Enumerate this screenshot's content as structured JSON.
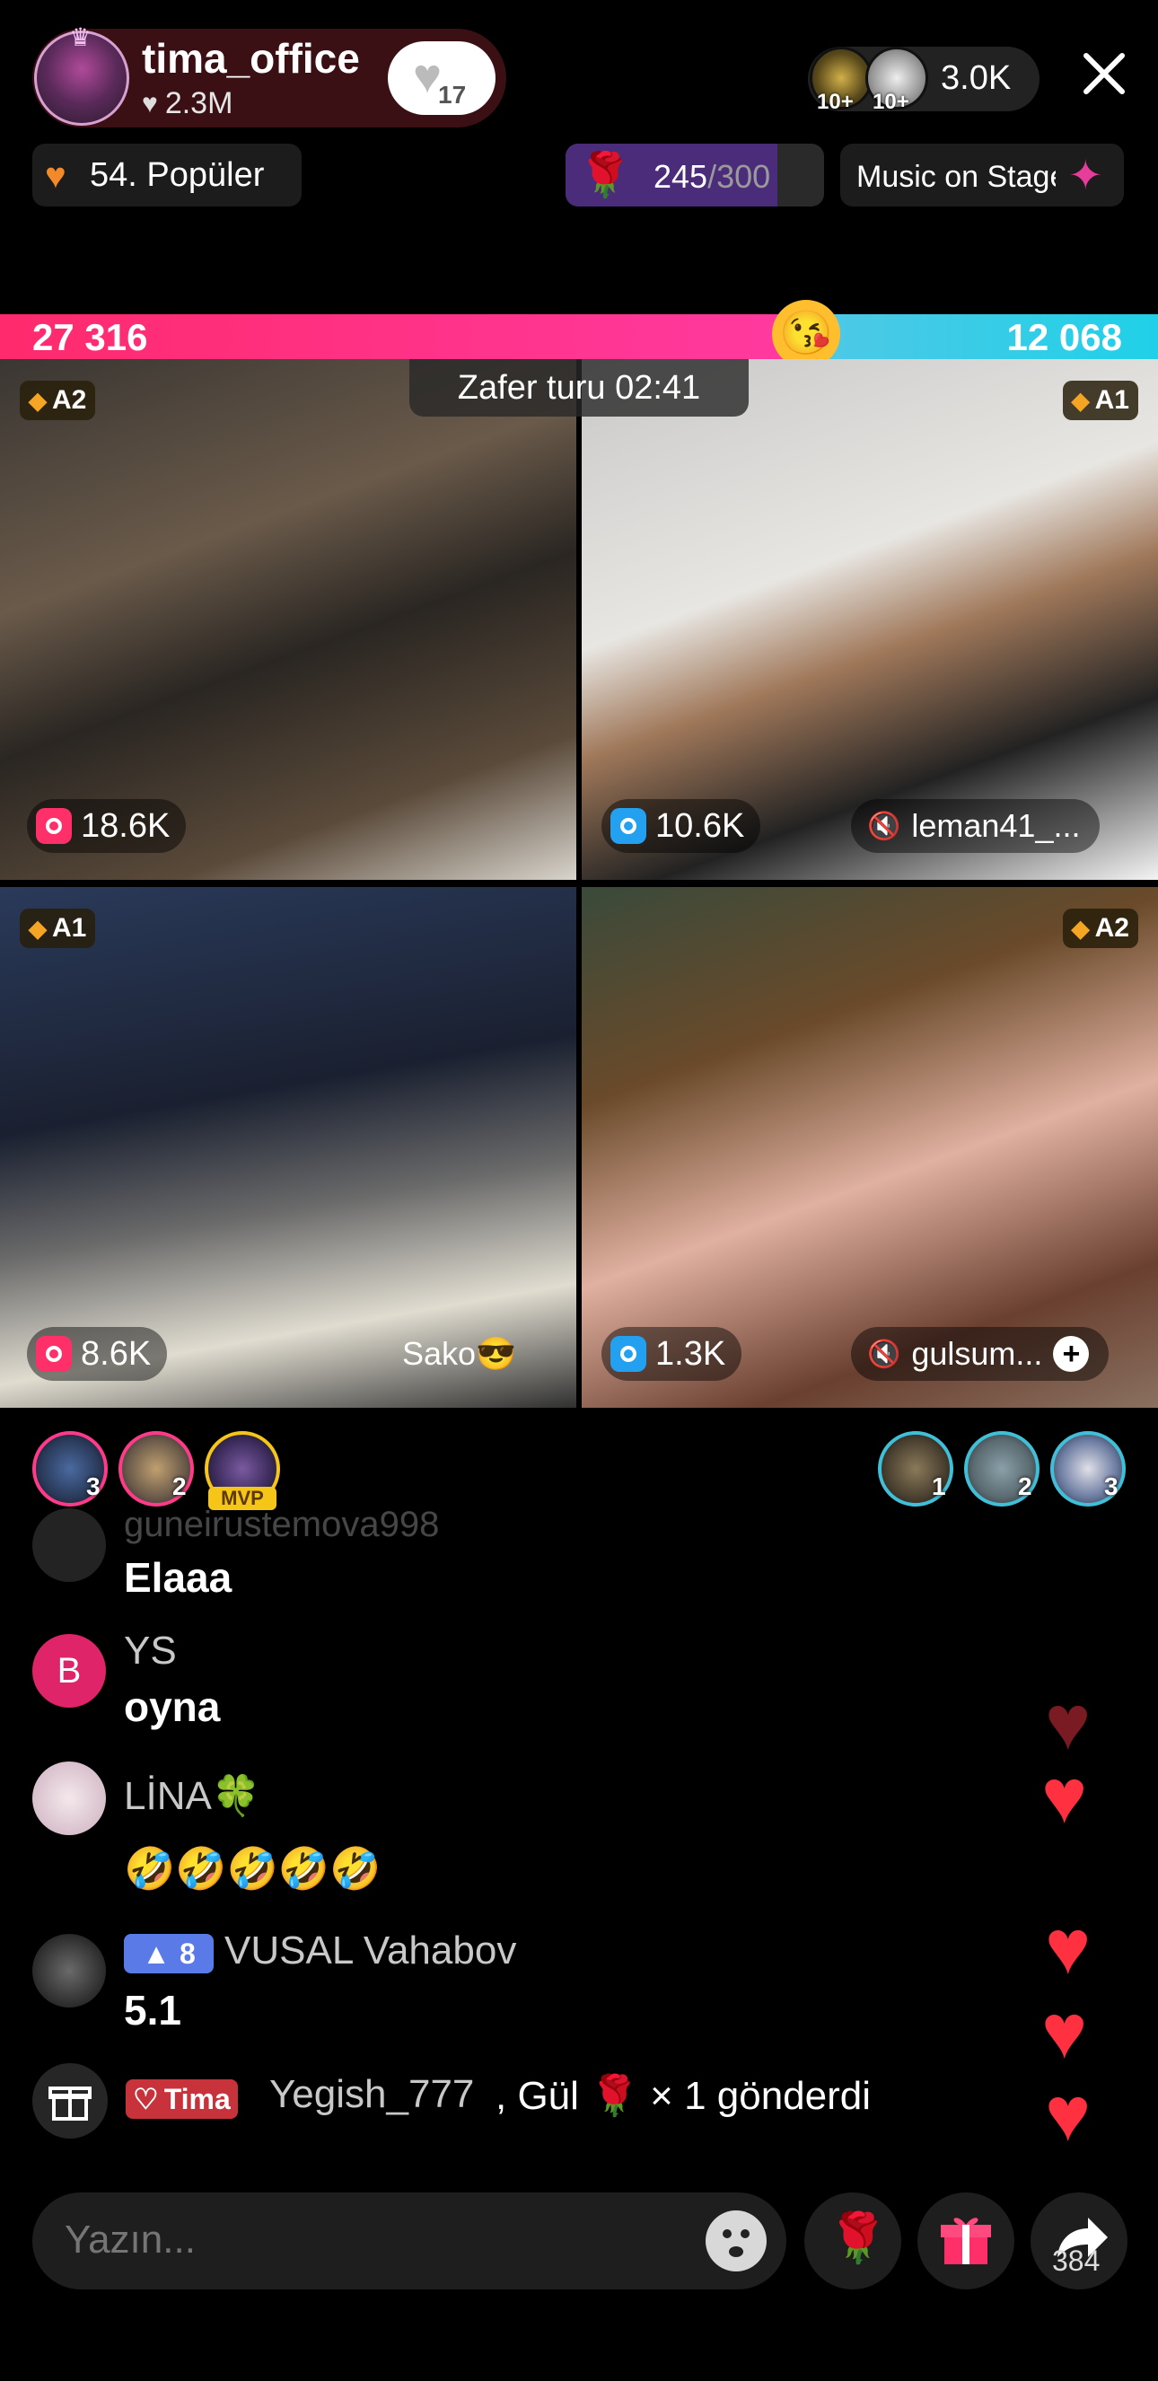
{
  "header": {
    "host_name": "tima_office",
    "host_likes": "2.3M",
    "follow_count": "17",
    "viewer_ranks": [
      "10+",
      "10+"
    ],
    "viewer_count": "3.0K",
    "popular_label": "54. Popüler",
    "rose_goal": {
      "current": "245",
      "max": "/300",
      "progress": 0.82
    },
    "music_label": "Music on Stage"
  },
  "battle": {
    "score_left": "27 316",
    "score_right": "12 068",
    "left_share": 0.695,
    "round_label": "Zafer turu 02:41"
  },
  "tiles": [
    {
      "tier": "A2",
      "stat": "18.6K",
      "name": "",
      "stat_color": "pink"
    },
    {
      "tier": "A1",
      "stat": "10.6K",
      "name": "leman41_...",
      "stat_color": "blue"
    },
    {
      "tier": "A1",
      "stat": "8.6K",
      "name": "Sako😎",
      "stat_color": "pink"
    },
    {
      "tier": "A2",
      "stat": "1.3K",
      "name": "gulsum...",
      "stat_color": "blue"
    }
  ],
  "supporters": {
    "left_ranks": [
      "3",
      "2"
    ],
    "mvp_label": "MVP",
    "right_ranks": [
      "1",
      "2",
      "3"
    ]
  },
  "chat": [
    {
      "user": "guneirustemova998",
      "message": "Elaaa",
      "avatar_letter": ""
    },
    {
      "user": "YS",
      "message": "oyna",
      "avatar_letter": "B"
    },
    {
      "user": "LİNA🍀",
      "message": "🤣🤣🤣🤣🤣",
      "avatar_letter": ""
    },
    {
      "user": "VUSAL Vahabov",
      "message": "5.1",
      "avatar_letter": "",
      "level": "8"
    }
  ],
  "gift_event": {
    "badge": "Tima",
    "text": "Yegish_777",
    "suffix": ", Gül 🌹 × 1 gönderdi"
  },
  "bottom": {
    "comment_placeholder": "Yazın...",
    "share_count": "384"
  },
  "colors": {
    "battle_left": "#ff2a6d",
    "battle_right": "#20d0e8",
    "heart": "#ff3040",
    "background": "#000000"
  }
}
